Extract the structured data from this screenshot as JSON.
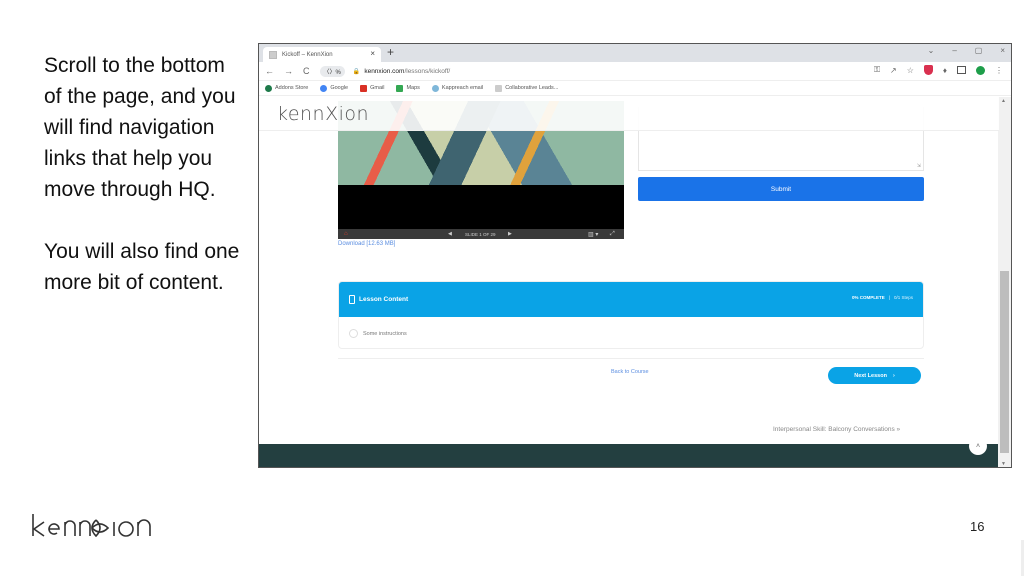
{
  "slide": {
    "paragraphs": [
      "Scroll to the bottom of the page, and you will find navigation links that help you move through HQ.",
      "You will also find one more bit of content."
    ],
    "logo_text": "kenn⌘ion",
    "page_number": "16"
  },
  "browser": {
    "tab_title": "Kickoff – KennXion",
    "tab_close": "×",
    "new_tab": "+",
    "window_controls": [
      "⌄",
      "–",
      "▢",
      "×"
    ],
    "nav": {
      "back": "←",
      "forward": "→",
      "reload": "C"
    },
    "omnibox_chip": "〈〉%",
    "url_host": "kennxion.com",
    "url_path": "/lessons/kickoff/",
    "toolbar_icons": [
      "key-icon",
      "share-icon",
      "star-icon",
      "shield-extension-icon",
      "puzzle-extensions-icon",
      "side-panel-icon",
      "green-check-extension-icon",
      "more-menu-icon"
    ],
    "bookmarks": [
      {
        "label": "Addons Store",
        "color": "#1e7a4a"
      },
      {
        "label": "Google",
        "color": "#4285f4"
      },
      {
        "label": "Gmail",
        "color": "#d93025"
      },
      {
        "label": "Maps",
        "color": "#34a853"
      },
      {
        "label": "Kappreach email",
        "color": "#7fb7d9"
      },
      {
        "label": "Collaborative Leads...",
        "color": "#cccccc"
      }
    ]
  },
  "page": {
    "site_logo": "kennXion",
    "slide_viewer": {
      "counter": "SLIDE 1 OF 29",
      "prev": "◀",
      "next": "▶",
      "layout": "▥ ▾",
      "fullscreen": "⤢",
      "home": "⌂"
    },
    "download_link": "Download [12.63 MB]",
    "submit_label": "Submit",
    "lesson_content": {
      "title": "Lesson Content",
      "progress": "0% COMPLETE",
      "steps": "0/1 Steps",
      "items": [
        {
          "label": "Some instructions",
          "completed": false
        }
      ]
    },
    "back_to_course": "Back to Course",
    "next_lesson": "Next Lesson",
    "next_lesson_chevron": "›",
    "next_topic": "Interpersonal Skill: Balcony Conversations  »",
    "scroll_top": "˄"
  },
  "colors": {
    "accent_blue": "#0aa3e6",
    "submit_blue": "#1a73e8",
    "footer": "#233f40",
    "link": "#5a8de0"
  }
}
